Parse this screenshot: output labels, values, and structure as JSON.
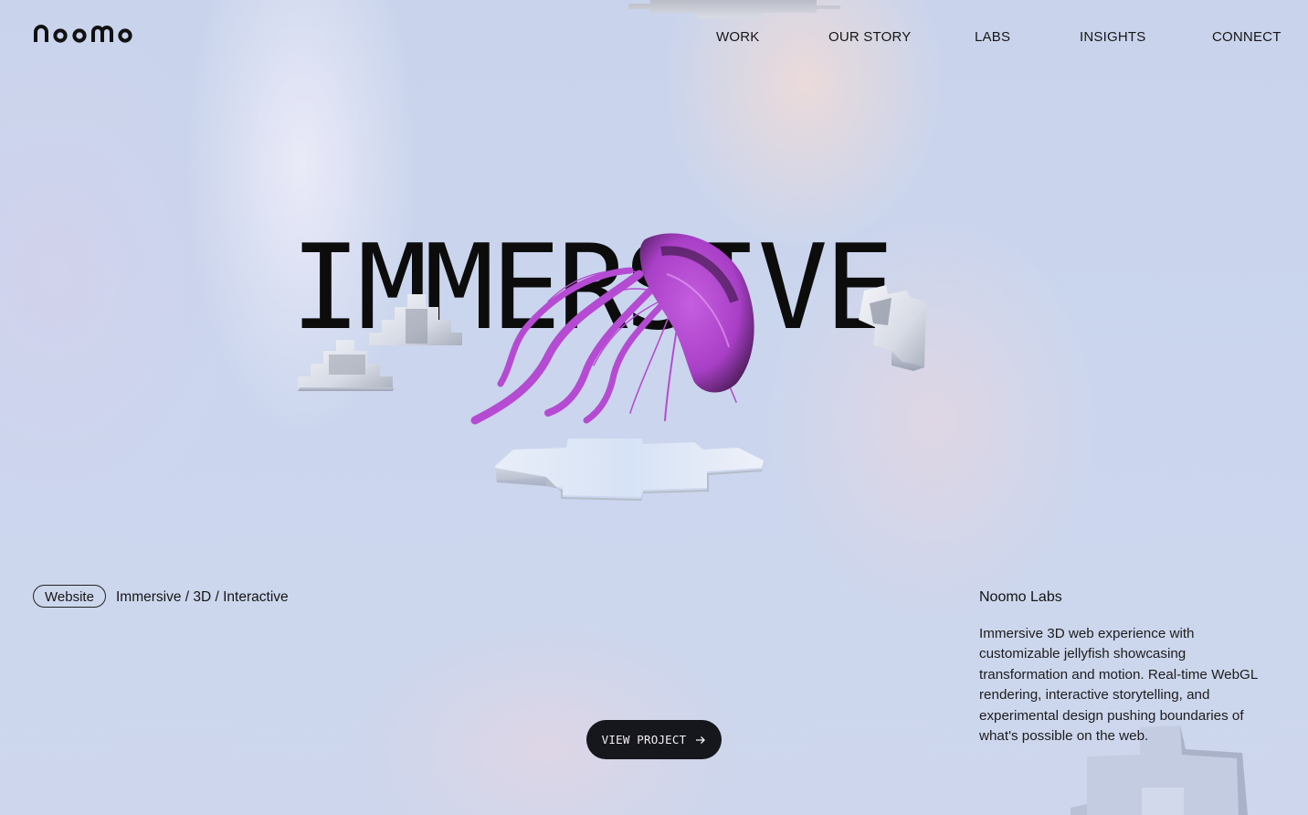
{
  "header": {
    "logo_text": "noomo",
    "nav": [
      {
        "label": "WORK"
      },
      {
        "label": "OUR STORY"
      },
      {
        "label": "LABS"
      },
      {
        "label": "INSIGHTS"
      },
      {
        "label": "CONNECT"
      }
    ]
  },
  "hero": {
    "title": "IMMERSIVE",
    "jellyfish_color": "#b54bd2"
  },
  "project": {
    "type_tag": "Website",
    "categories": "Immersive / 3D / Interactive",
    "name": "Noomo Labs",
    "description": "Immersive 3D web experience with customizable jellyfish showcasing transformation and motion. Real-time WebGL rendering, interactive storytelling, and experimental design pushing boundaries of what's possible on the web.",
    "cta_label": "VIEW PROJECT"
  },
  "colors": {
    "background": "#cbd5ed",
    "text": "#141414",
    "button_bg": "#16161d",
    "accent": "#b54bd2"
  },
  "icons": [
    "noomo-logo",
    "arrow-right-icon"
  ]
}
